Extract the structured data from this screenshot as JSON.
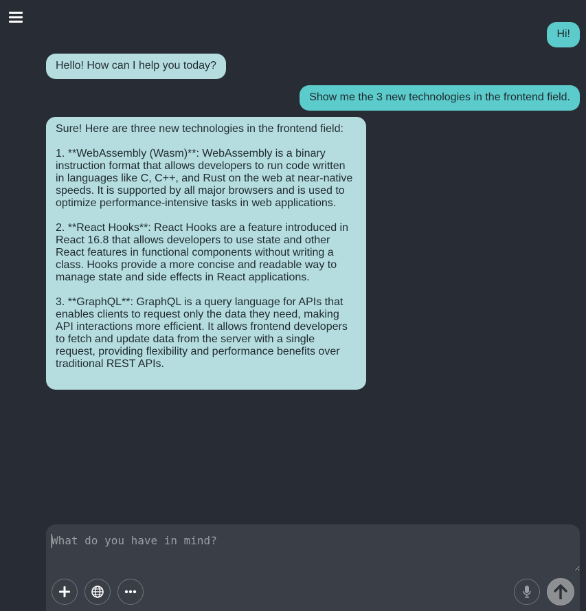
{
  "menu": {
    "icon": "hamburger-menu-icon"
  },
  "messages": [
    {
      "role": "user",
      "text": "Hi!"
    },
    {
      "role": "assistant",
      "text": "Hello! How can I help you today?"
    },
    {
      "role": "user",
      "text": "Show me the 3 new technologies in the frontend field."
    },
    {
      "role": "assistant",
      "text": "Sure! Here are three new technologies in the frontend field:\n\n1. **WebAssembly (Wasm)**: WebAssembly is a binary instruction format that allows developers to run code written in languages like C, C++, and Rust on the web at near-native speeds. It is supported by all major browsers and is used to optimize performance-intensive tasks in web applications.\n\n2. **React Hooks**: React Hooks are a feature introduced in React 16.8 that allows developers to use state and other React features in functional components without writing a class. Hooks provide a more concise and readable way to manage state and side effects in React applications.\n\n3. **GraphQL**: GraphQL is a query language for APIs that enables clients to request only the data they need, making API interactions more efficient. It allows frontend developers to fetch and update data from the server with a single request, providing flexibility and performance benefits over traditional REST APIs."
    }
  ],
  "composer": {
    "placeholder": "What do you have in mind?",
    "value": "",
    "buttons": {
      "add": "plus-icon",
      "web": "globe-icon",
      "more": "more-dots-icon",
      "mic": "microphone-icon",
      "send": "arrow-up-icon"
    }
  },
  "colors": {
    "background": "#282c34",
    "user_bubble": "#5ccbcc",
    "assistant_bubble": "#b5dde0",
    "composer": "#3a3e46"
  }
}
